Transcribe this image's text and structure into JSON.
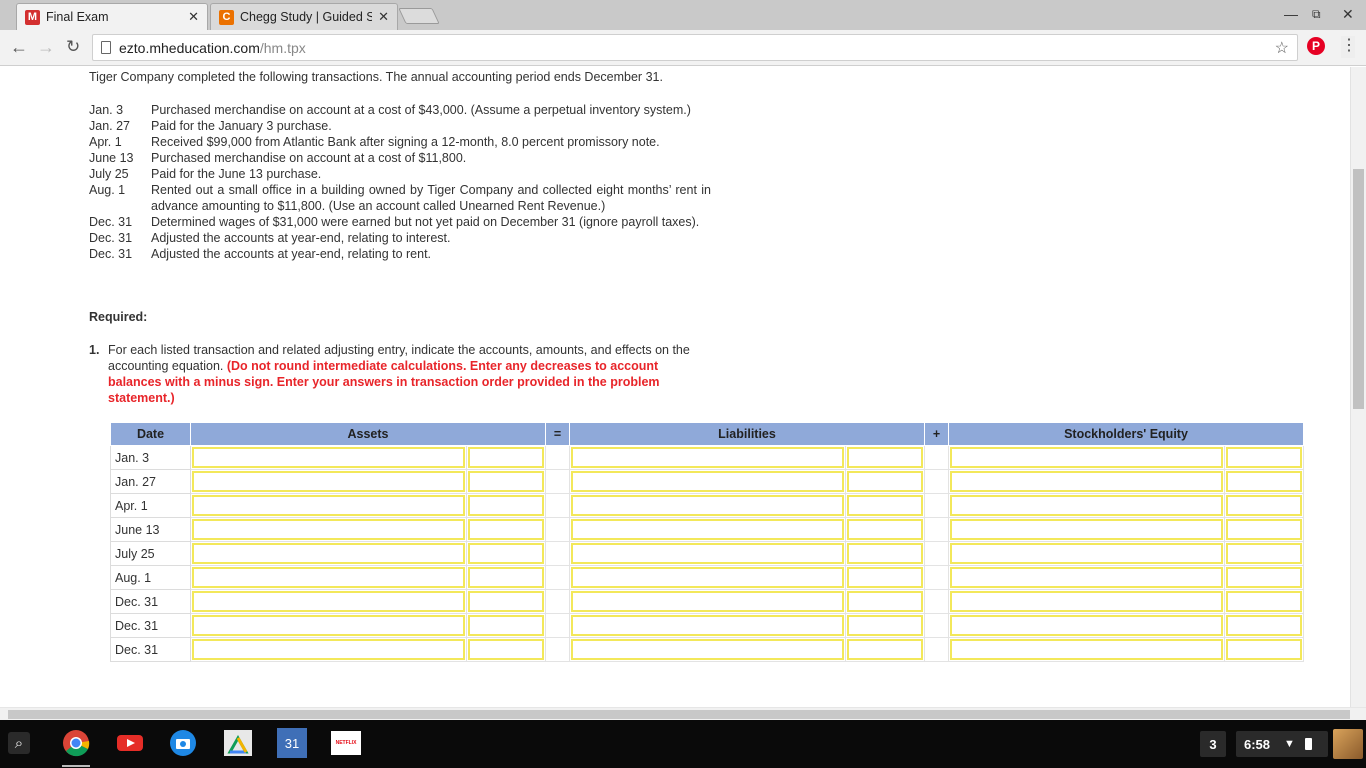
{
  "browser": {
    "tabs": [
      {
        "title": "Final Exam",
        "favicon": "M",
        "favicon_color": "#d32f2f",
        "active": true
      },
      {
        "title": "Chegg Study | Guided So",
        "favicon": "C",
        "favicon_color": "#eb7100",
        "active": false
      }
    ],
    "url_host": "ezto.mheducation.com",
    "url_path": "/hm.tpx"
  },
  "page": {
    "intro": "Tiger Company completed the following transactions. The annual accounting period ends December 31.",
    "transactions": [
      {
        "date": "Jan. 3",
        "desc": "Purchased merchandise on account at a cost of $43,000. (Assume a perpetual inventory system.)"
      },
      {
        "date": "Jan. 27",
        "desc": "Paid for the January 3 purchase."
      },
      {
        "date": "Apr. 1",
        "desc": "Received $99,000 from Atlantic Bank after signing a 12-month, 8.0 percent promissory note."
      },
      {
        "date": "June 13",
        "desc": "Purchased merchandise on account at a cost of $11,800."
      },
      {
        "date": "July 25",
        "desc": "Paid for the June 13 purchase."
      },
      {
        "date": "Aug. 1",
        "desc": "Rented out a small office in a building owned by Tiger Company and collected eight months’ rent in advance amounting to $11,800. (Use an account called Unearned Rent Revenue.)"
      },
      {
        "date": "Dec. 31",
        "desc": "Determined wages of $31,000 were earned but not yet paid on December 31 (ignore payroll taxes)."
      },
      {
        "date": "Dec. 31",
        "desc": "Adjusted the accounts at year-end, relating to interest."
      },
      {
        "date": "Dec. 31",
        "desc": "Adjusted the accounts at year-end, relating to rent."
      }
    ],
    "required_label": "Required:",
    "question": {
      "number": "1.",
      "text": "For each listed transaction and related adjusting entry, indicate the accounts, amounts, and effects on the accounting equation. ",
      "instruction": "(Do not round intermediate calculations. Enter any decreases to account balances with a minus sign. Enter your answers in transaction order provided in the problem statement.)"
    },
    "table": {
      "headers": {
        "date": "Date",
        "assets": "Assets",
        "eq": "=",
        "liabilities": "Liabilities",
        "plus": "+",
        "equity": "Stockholders' Equity"
      },
      "rows": [
        "Jan. 3",
        "Jan. 27",
        "Apr. 1",
        "June 13",
        "July 25",
        "Aug. 1",
        "Dec. 31",
        "Dec. 31",
        "Dec. 31"
      ]
    }
  },
  "shelf": {
    "apps": [
      "chrome-icon",
      "youtube-icon",
      "camera-icon",
      "drive-icon",
      "calendar-icon",
      "netflix-icon"
    ],
    "calendar_day": "31",
    "netflix_label": "NETFLIX",
    "notification_count": "3",
    "time": "6:58"
  }
}
